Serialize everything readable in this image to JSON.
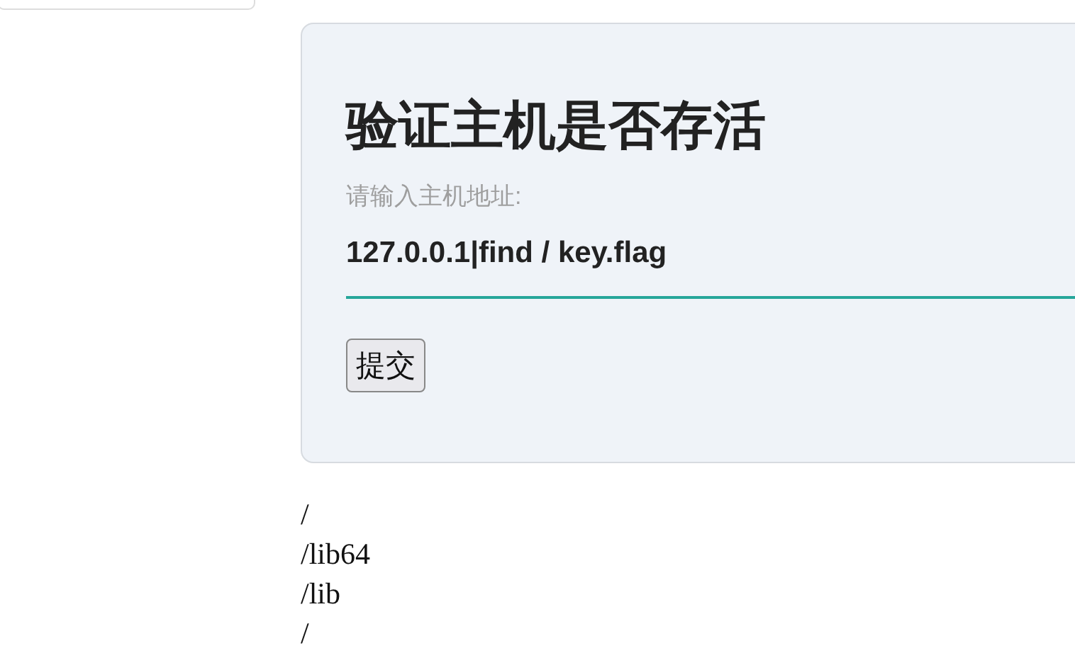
{
  "form": {
    "title": "验证主机是否存活",
    "label": "请输入主机地址:",
    "input": {
      "value": "127.0.0.1|find / key.flag"
    },
    "submit": "提交"
  },
  "output": {
    "lines": [
      "/",
      "/lib64",
      "/lib",
      "/"
    ]
  }
}
